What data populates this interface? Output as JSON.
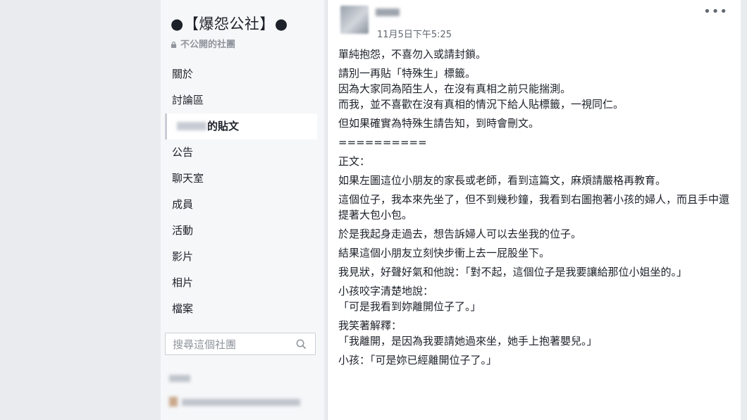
{
  "sidebar": {
    "group_title": "●【爆怨公社】●",
    "privacy_label": "不公開的社團",
    "nav_items": [
      {
        "label": "關於"
      },
      {
        "label": "討論區"
      },
      {
        "label": "的貼文"
      },
      {
        "label": "公告"
      },
      {
        "label": "聊天室"
      },
      {
        "label": "成員"
      },
      {
        "label": "活動"
      },
      {
        "label": "影片"
      },
      {
        "label": "相片"
      },
      {
        "label": "檔案"
      }
    ],
    "search_placeholder": "搜尋這個社團"
  },
  "post": {
    "timestamp": "11月5日下午5:25",
    "more_label": "•••",
    "paragraphs": [
      "單純抱怨，不喜勿入或請封鎖。",
      "請別一再貼「特殊生」標籤。\n因為大家同為陌生人，在沒有真相之前只能揣測。\n而我，並不喜歡在沒有真相的情況下給人貼標籤，一視同仁。",
      "但如果確實為特殊生請告知，到時會刪文。",
      "==========",
      "正文：",
      "如果左圖這位小朋友的家長或老師，看到這篇文，麻煩請嚴格再教育。",
      "這個位子，我本來先坐了，但不到幾秒鐘，我看到右圖抱著小孩的婦人，而且手中還提著大包小包。",
      "於是我起身走過去，想告訴婦人可以去坐我的位子。",
      "結果這個小朋友立刻快步衝上去一屁股坐下。",
      "我見狀，好聲好氣和他說：「對不起，這個位子是我要讓給那位小姐坐的。」",
      "小孩咬字清楚地說：\n「可是我看到妳離開位子了。」",
      "我笑著解釋：\n「我離開，是因為我要請她過來坐，她手上抱著嬰兒。」",
      "小孩：「可是妳已經離開位子了。」"
    ]
  }
}
